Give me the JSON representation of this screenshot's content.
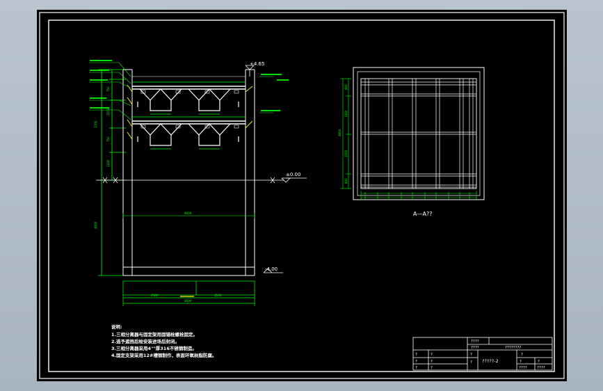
{
  "elevations": {
    "top": "+4.65",
    "zero": "±0.00",
    "bottom": "-4.00"
  },
  "section_label": "A—A??",
  "notes": {
    "title": "说明:",
    "lines": [
      "1.三相分离器与固定架用固锚栓螺栓固定。",
      "2.选予遮挡后检安装进场后封闭。",
      "3.三相分离器采用4\"\"厚316不锈钢制造。",
      "4.固定支架采用12#槽钢制作，表面环氧树脂防腐。"
    ]
  },
  "title_block": {
    "r1": "????",
    "r2a": "????",
    "r2b": "????????",
    "q": "?",
    "drawing_no": "?????-2",
    "f1": "????",
    "f2": "????"
  },
  "colors": {
    "background": "#000000",
    "frame": "#ffffff",
    "dimension": "#00ff00",
    "highlight": "#ffff00"
  }
}
